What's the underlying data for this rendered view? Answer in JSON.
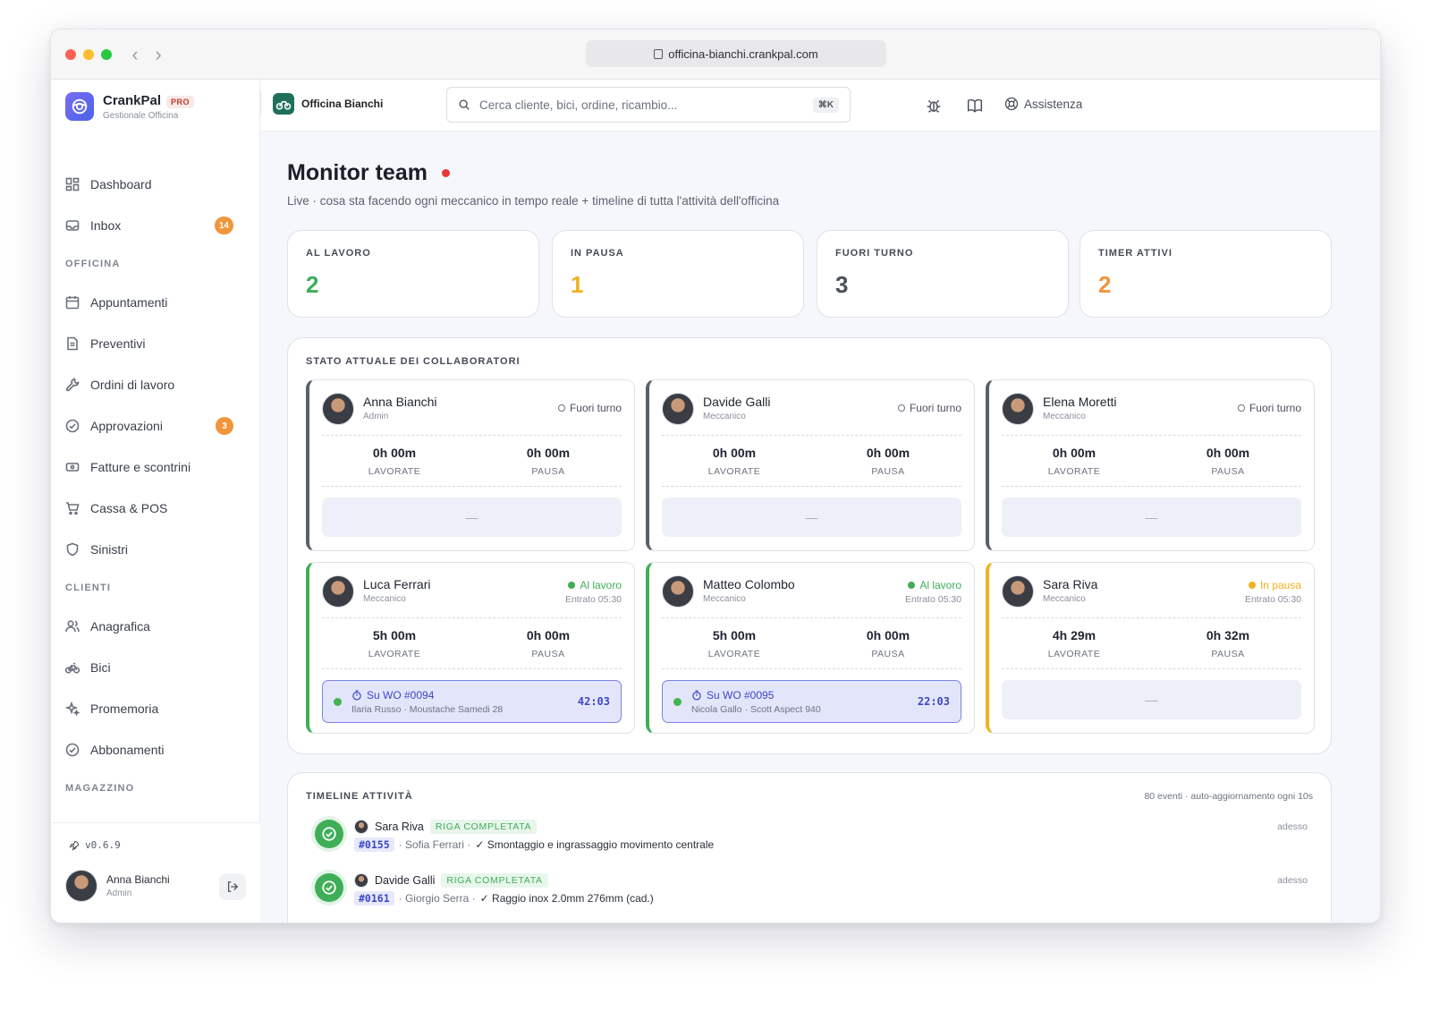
{
  "browser": {
    "url": "officina-bianchi.crankpal.com"
  },
  "app": {
    "name": "CrankPal",
    "badge": "PRO",
    "subtitle": "Gestionale Officina",
    "workshop": "Officina Bianchi",
    "version": "v0.6.9"
  },
  "search": {
    "placeholder": "Cerca cliente, bici, ordine, ricambio...",
    "shortcut": "⌘K"
  },
  "topbar": {
    "assist_label": "Assistenza",
    "icons": [
      "bug-icon",
      "book-icon",
      "lifebuoy-icon"
    ]
  },
  "sidebar": {
    "items_top": [
      {
        "label": "Dashboard",
        "icon": "grid-icon"
      },
      {
        "label": "Inbox",
        "icon": "inbox-icon",
        "badge": "14"
      }
    ],
    "section_officina": "OFFICINA",
    "items_officina": [
      {
        "label": "Appuntamenti",
        "icon": "calendar-icon"
      },
      {
        "label": "Preventivi",
        "icon": "document-icon"
      },
      {
        "label": "Ordini di lavoro",
        "icon": "wrench-icon"
      },
      {
        "label": "Approvazioni",
        "icon": "check-circle-icon",
        "badge": "3"
      },
      {
        "label": "Fatture e scontrini",
        "icon": "receipt-icon"
      },
      {
        "label": "Cassa & POS",
        "icon": "cart-icon"
      },
      {
        "label": "Sinistri",
        "icon": "shield-icon"
      }
    ],
    "section_clienti": "CLIENTI",
    "items_clienti": [
      {
        "label": "Anagrafica",
        "icon": "users-icon"
      },
      {
        "label": "Bici",
        "icon": "bike-icon"
      },
      {
        "label": "Promemoria",
        "icon": "sparkle-icon"
      },
      {
        "label": "Abbonamenti",
        "icon": "check-circle-icon"
      }
    ],
    "section_magazzino": "MAGAZZINO",
    "user": {
      "name": "Anna Bianchi",
      "role": "Admin"
    }
  },
  "page": {
    "title": "Monitor team",
    "subtitle": "Live · cosa sta facendo ogni meccanico in tempo reale + timeline di tutta l'attività dell'officina"
  },
  "stats": [
    {
      "label": "AL LAVORO",
      "value": "2",
      "color": "#3fae58"
    },
    {
      "label": "IN PAUSA",
      "value": "1",
      "color": "#f2b01e"
    },
    {
      "label": "FUORI TURNO",
      "value": "3",
      "color": "#4a505c"
    },
    {
      "label": "TIMER ATTIVI",
      "value": "2",
      "color": "#f0953a"
    }
  ],
  "collab": {
    "title": "STATO ATTUALE DEI COLLABORATORI",
    "worked_label": "LAVORATE",
    "pause_label": "PAUSA",
    "empty": "—",
    "cards": [
      {
        "name": "Anna Bianchi",
        "role": "Admin",
        "status": "Fuori turno",
        "status_color": "#4a505c",
        "entry": "",
        "worked": "0h 00m",
        "pause": "0h 00m"
      },
      {
        "name": "Davide Galli",
        "role": "Meccanico",
        "status": "Fuori turno",
        "status_color": "#4a505c",
        "entry": "",
        "worked": "0h 00m",
        "pause": "0h 00m"
      },
      {
        "name": "Elena Moretti",
        "role": "Meccanico",
        "status": "Fuori turno",
        "status_color": "#4a505c",
        "entry": "",
        "worked": "0h 00m",
        "pause": "0h 00m"
      },
      {
        "name": "Luca Ferrari",
        "role": "Meccanico",
        "status": "Al lavoro",
        "status_color": "#3fae58",
        "entry": "Entrato 05:30",
        "worked": "5h 00m",
        "pause": "0h 00m",
        "wo": {
          "title": "Su WO #0094",
          "sub": "Ilaria Russo · Moustache Samedi 28",
          "clock": "42:03"
        }
      },
      {
        "name": "Matteo Colombo",
        "role": "Meccanico",
        "status": "Al lavoro",
        "status_color": "#3fae58",
        "entry": "Entrato 05:30",
        "worked": "5h 00m",
        "pause": "0h 00m",
        "wo": {
          "title": "Su WO #0095",
          "sub": "Nicola Gallo · Scott Aspect 940",
          "clock": "22:03"
        }
      },
      {
        "name": "Sara Riva",
        "role": "Meccanico",
        "status": "In pausa",
        "status_color": "#f2b01e",
        "entry": "Entrato 05:30",
        "worked": "4h 29m",
        "pause": "0h 32m"
      }
    ]
  },
  "timeline": {
    "title": "TIMELINE ATTIVITÀ",
    "meta": "80 eventi · auto-aggiornamento ogni 10s",
    "events": [
      {
        "user": "Sara Riva",
        "tag": "RIGA COMPLETATA",
        "wo": "#0155",
        "customer": "· Sofia Ferrari ·",
        "desc": "✓ Smontaggio e ingrassaggio movimento centrale",
        "time": "adesso"
      },
      {
        "user": "Davide Galli",
        "tag": "RIGA COMPLETATA",
        "wo": "#0161",
        "customer": "· Giorgio Serra ·",
        "desc": "✓ Raggio inox 2.0mm 276mm (cad.)",
        "time": "adesso"
      }
    ]
  }
}
